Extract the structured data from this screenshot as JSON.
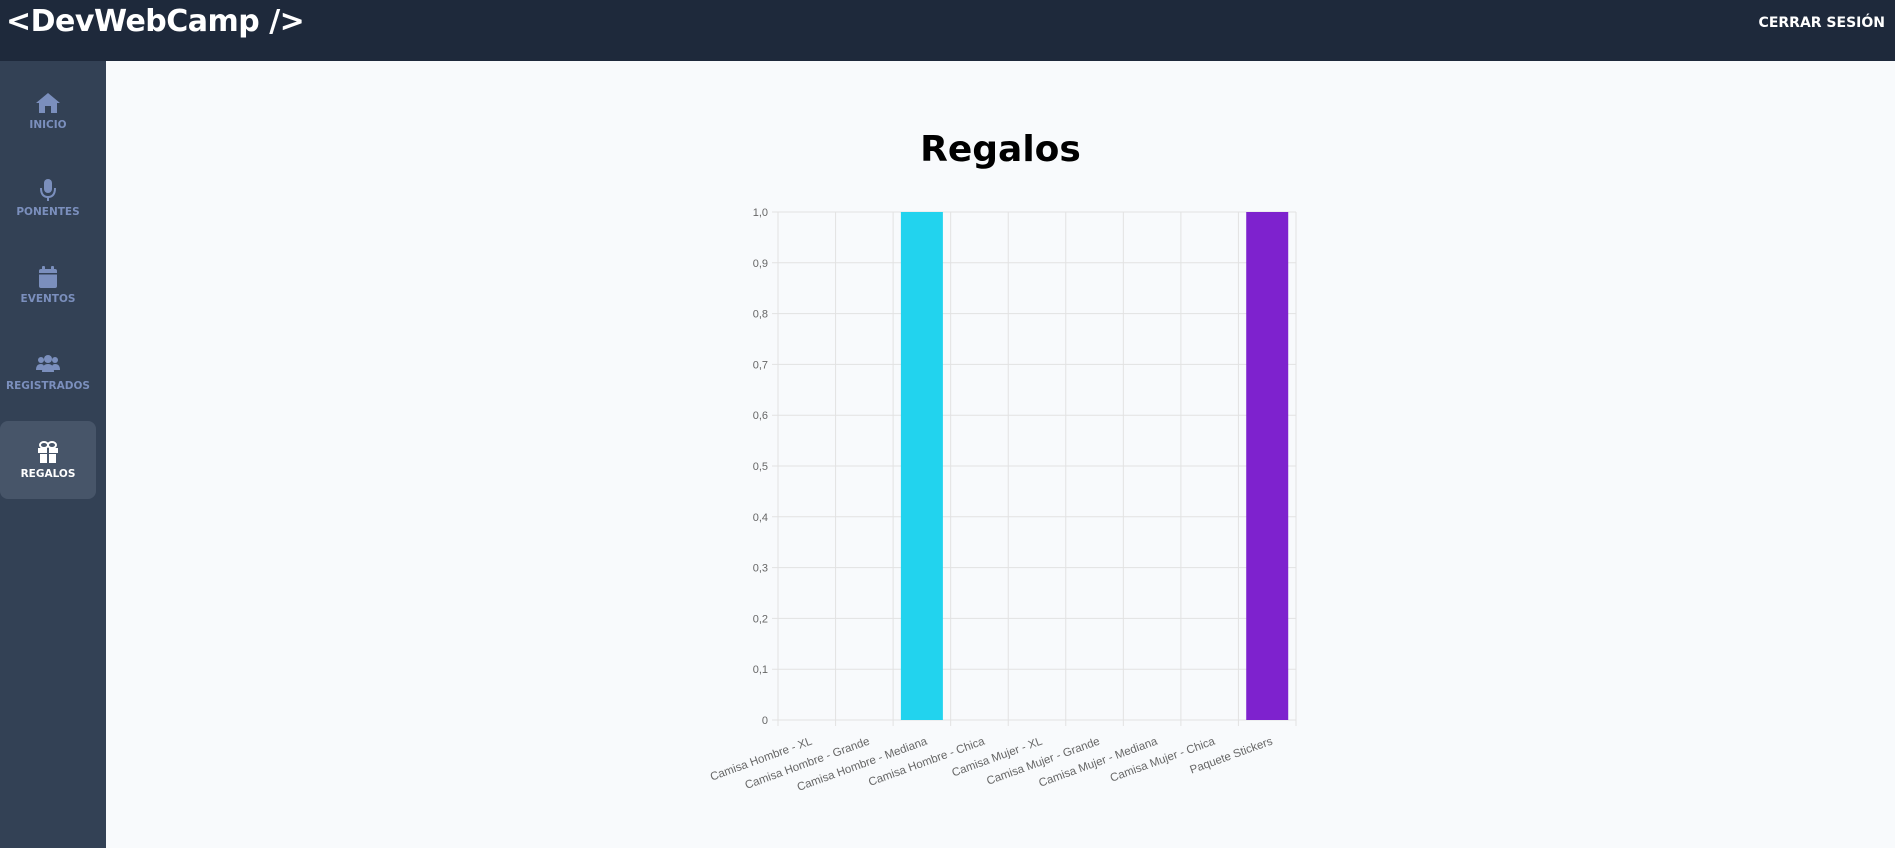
{
  "header": {
    "logo": "<DevWebCamp />",
    "logout_label": "CERRAR SESIÓN"
  },
  "sidebar": {
    "items": [
      {
        "label": "INICIO",
        "icon": "house-icon",
        "active": false
      },
      {
        "label": "PONENTES",
        "icon": "microphone-icon",
        "active": false
      },
      {
        "label": "EVENTOS",
        "icon": "calendar-icon",
        "active": false
      },
      {
        "label": "REGISTRADOS",
        "icon": "users-icon",
        "active": false
      },
      {
        "label": "REGALOS",
        "icon": "gift-icon",
        "active": true
      }
    ]
  },
  "main": {
    "title": "Regalos"
  },
  "chart_data": {
    "type": "bar",
    "title": "",
    "xlabel": "",
    "ylabel": "",
    "categories": [
      "Camisa Hombre - XL",
      "Camisa Hombre - Grande",
      "Camisa Hombre - Mediana",
      "Camisa Hombre - Chica",
      "Camisa Mujer - XL",
      "Camisa Mujer - Grande",
      "Camisa Mujer - Mediana",
      "Camisa Mujer - Chica",
      "Paquete Stickers"
    ],
    "values": [
      0,
      0,
      1,
      0,
      0,
      0,
      0,
      0,
      1
    ],
    "bar_colors": [
      "#ea580c",
      "#84cc16",
      "#22d3ee",
      "#a855f7",
      "#ef4444",
      "#14b8a6",
      "#db2777",
      "#e11d48",
      "#7e22ce"
    ],
    "ylim": [
      0,
      1
    ],
    "yticks": [
      "0",
      "0,1",
      "0,2",
      "0,3",
      "0,4",
      "0,5",
      "0,6",
      "0,7",
      "0,8",
      "0,9",
      "1,0"
    ],
    "grid": true,
    "legend": "none"
  }
}
